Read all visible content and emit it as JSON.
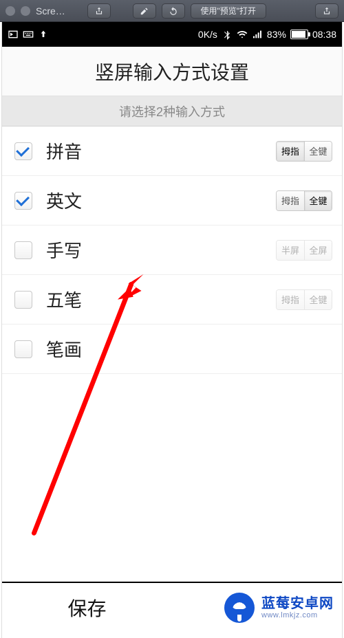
{
  "mac_toolbar": {
    "title": "Scre…",
    "open_with_preview": "使用\"预览\"打开"
  },
  "statusbar": {
    "speed": "0K/s",
    "battery_pct": "83%",
    "time": "08:38"
  },
  "page": {
    "title": "竖屏输入方式设置",
    "instruction": "请选择2种输入方式"
  },
  "rows": [
    {
      "label": "拼音",
      "checked": true,
      "opts": [
        "拇指",
        "全键"
      ],
      "selected": 0,
      "dim": false
    },
    {
      "label": "英文",
      "checked": true,
      "opts": [
        "拇指",
        "全键"
      ],
      "selected": 1,
      "dim": false
    },
    {
      "label": "手写",
      "checked": false,
      "opts": [
        "半屏",
        "全屏"
      ],
      "selected": -1,
      "dim": true
    },
    {
      "label": "五笔",
      "checked": false,
      "opts": [
        "拇指",
        "全键"
      ],
      "selected": -1,
      "dim": true
    },
    {
      "label": "笔画",
      "checked": false,
      "opts": null
    }
  ],
  "save_label": "保存",
  "watermark": {
    "brand": "蓝莓安卓网",
    "url": "www.lmkjz.com"
  }
}
